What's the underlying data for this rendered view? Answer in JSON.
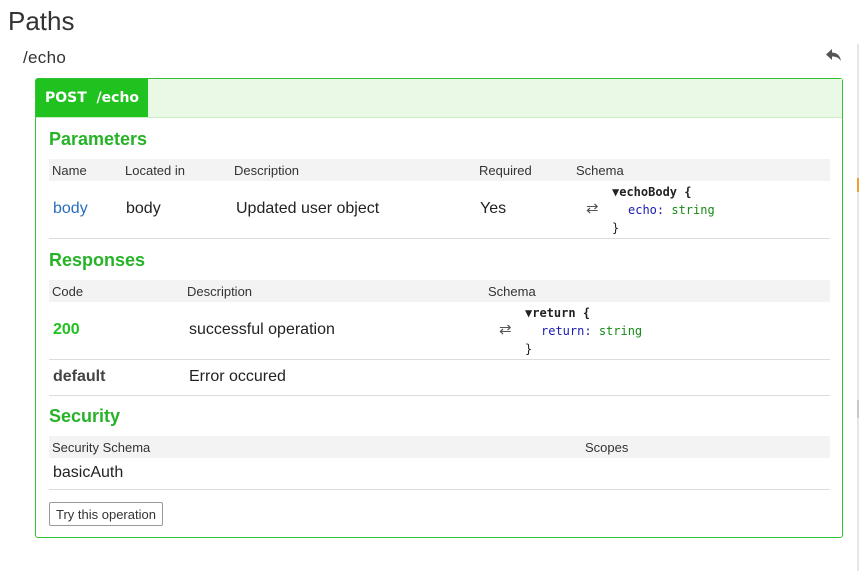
{
  "page": {
    "title": "Paths"
  },
  "path": {
    "name": "/echo"
  },
  "operation": {
    "method": "POST",
    "path": "/echo",
    "badge_color": "#1fc21f",
    "accent_color": "#27b327"
  },
  "parameters": {
    "title": "Parameters",
    "headers": [
      "Name",
      "Located in",
      "Description",
      "Required",
      "Schema"
    ],
    "rows": [
      {
        "name": "body",
        "located_in": "body",
        "description": "Updated user object",
        "required": "Yes",
        "schema": {
          "name": "echoBody",
          "prop": "echo:",
          "type": "string"
        }
      }
    ]
  },
  "responses": {
    "title": "Responses",
    "headers": [
      "Code",
      "Description",
      "Schema"
    ],
    "rows": [
      {
        "code": "200",
        "description": "successful operation",
        "schema": {
          "name": "return",
          "prop": "return:",
          "type": "string"
        }
      },
      {
        "code": "default",
        "description": "Error occured"
      }
    ]
  },
  "security": {
    "title": "Security",
    "headers": [
      "Security Schema",
      "Scopes"
    ],
    "rows": [
      {
        "schema": "basicAuth",
        "scopes": ""
      }
    ]
  },
  "actions": {
    "try_label": "Try this operation"
  },
  "icons": {
    "back": "reply-arrow-icon",
    "swap": "swap-arrows-icon",
    "triangle": "triangle-down-icon"
  }
}
